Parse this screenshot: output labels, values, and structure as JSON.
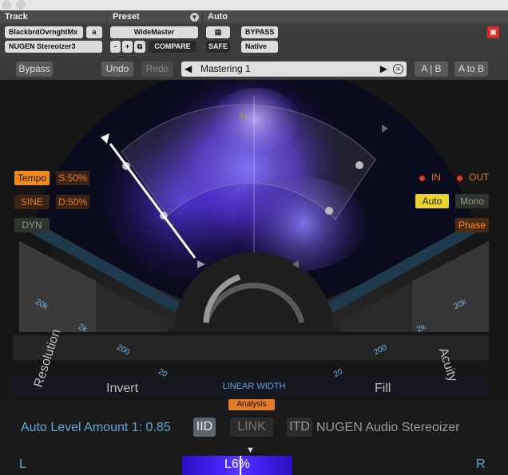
{
  "host": {
    "track_header": "Track",
    "preset_header": "Preset",
    "auto_header": "Auto",
    "track_name": "BlackbrdOvrnghtMx",
    "track_slot": "a",
    "plugin_name": "NUGEN Stereoizer3",
    "preset_name": "WideMaster",
    "minus": "-",
    "plus": "+",
    "compare": "COMPARE",
    "safe": "SAFE",
    "bypass": "BYPASS",
    "native": "Native"
  },
  "toolbar": {
    "bypass": "Bypass",
    "undo": "Undo",
    "redo": "Redo",
    "preset": "Mastering 1",
    "ab": "A | B",
    "a_to_b": "A to B"
  },
  "controls": {
    "tempo": "Tempo",
    "s50": "S:50%",
    "sine": "SINE",
    "d50": "D:50%",
    "dyn": "DYN",
    "in": "IN",
    "out": "OUT",
    "auto": "Auto",
    "mono": "Mono",
    "phase": "Phase"
  },
  "dial": {
    "resolution": "Resolution",
    "invert": "Invert",
    "fill": "Fill",
    "acuity": "Acuity",
    "linear_width": "LINEAR WIDTH",
    "analysis": "Analysis",
    "left_ticks": [
      "20k",
      "2k",
      "200",
      "20"
    ],
    "right_ticks": [
      "20k",
      "2k",
      "200",
      "20"
    ]
  },
  "footer": {
    "auto_level": "Auto Level Amount 1: 0.85",
    "iid": "IID",
    "link": "LINK",
    "itd": "ITD",
    "product": "NUGEN Audio Stereoizer",
    "left": "L",
    "right": "R",
    "balance": "L6%"
  },
  "colors": {
    "accent_orange": "#f28a22",
    "accent_yellow": "#e8d230",
    "tick_blue": "#6fb7e8",
    "indicator_red": "#e03a2a",
    "spectrum_purple": "#6a4cff"
  },
  "icons": {
    "preset_menu": "chevron-down-icon",
    "copy": "copy-icon",
    "close": "close-icon",
    "prev": "triangle-left-icon",
    "next": "triangle-right-icon",
    "list": "list-icon"
  }
}
